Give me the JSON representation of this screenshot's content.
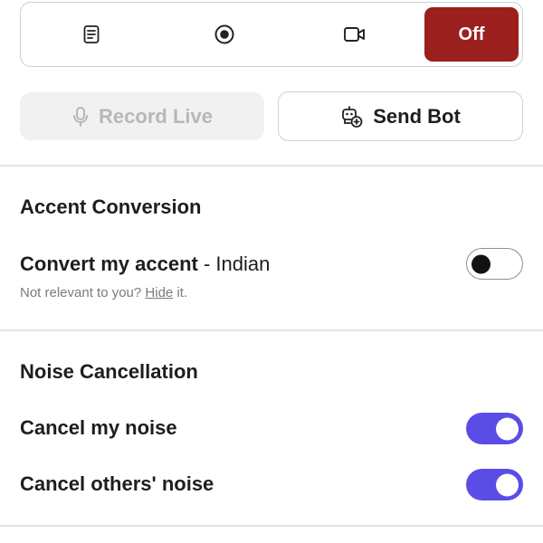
{
  "mode_bar": {
    "buttons": [
      {
        "icon": "notes-icon"
      },
      {
        "icon": "record-icon"
      },
      {
        "icon": "video-camera-icon"
      }
    ],
    "off_label": "Off",
    "selected": "Off",
    "selected_color": "#9b1f1c"
  },
  "actions": {
    "record_live_label": "Record Live",
    "record_live_icon": "microphone-icon",
    "record_live_disabled": true,
    "send_bot_label": "Send Bot",
    "send_bot_icon": "bot-add-icon"
  },
  "accent_conversion": {
    "title": "Accent Conversion",
    "label": "Convert my accent",
    "separator": " - ",
    "language": "Indian",
    "enabled": false,
    "hint_prefix": "Not relevant to you? ",
    "hint_link": "Hide",
    "hint_suffix": " it."
  },
  "noise_cancellation": {
    "title": "Noise Cancellation",
    "items": [
      {
        "label": "Cancel my noise",
        "enabled": true
      },
      {
        "label": "Cancel others' noise",
        "enabled": true
      }
    ],
    "toggle_on_color": "#5b4ce6"
  }
}
